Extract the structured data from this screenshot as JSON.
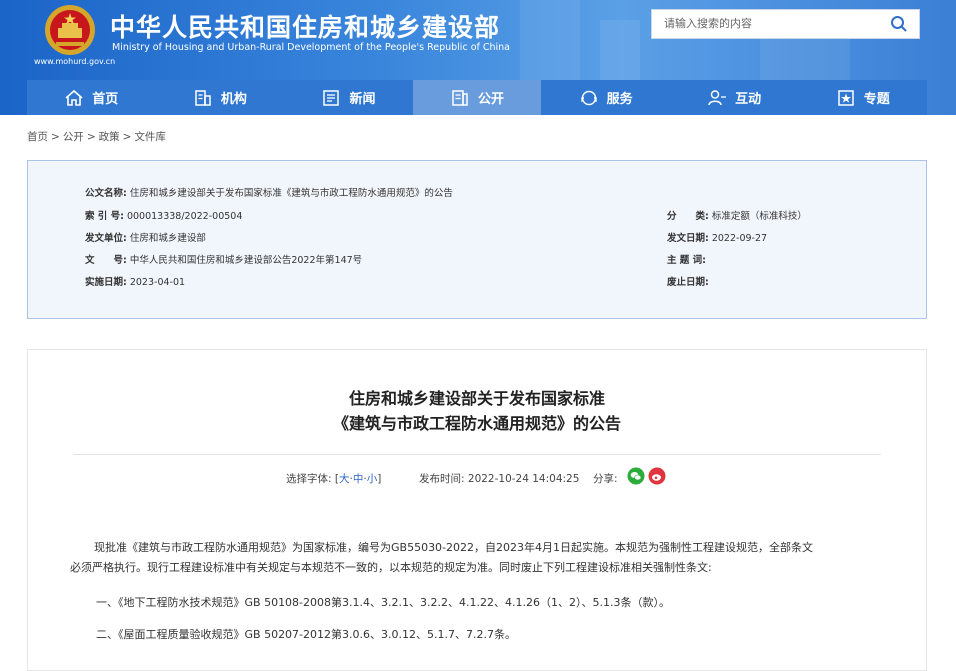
{
  "header": {
    "site_title": "中华人民共和国住房和城乡建设部",
    "site_subtitle": "Ministry of Housing and Urban-Rural Development of the People's Republic of China",
    "url": "www.mohurd.gov.cn",
    "search_placeholder": "请输入搜索的内容"
  },
  "nav": [
    {
      "label": "首页",
      "icon": "home-icon"
    },
    {
      "label": "机构",
      "icon": "building-icon"
    },
    {
      "label": "新闻",
      "icon": "news-icon"
    },
    {
      "label": "公开",
      "icon": "disclosure-icon",
      "active": true
    },
    {
      "label": "服务",
      "icon": "service-icon"
    },
    {
      "label": "互动",
      "icon": "interact-icon"
    },
    {
      "label": "专题",
      "icon": "topic-icon"
    }
  ],
  "breadcrumb": [
    "首页",
    "公开",
    "政策",
    "文件库"
  ],
  "info": {
    "title_key": "公文名称:",
    "title_val": "住房和城乡建设部关于发布国家标准《建筑与市政工程防水通用规范》的公告",
    "index_key": "索 引 号:",
    "index_val": "000013338/2022-00504",
    "category_key": "分　　类:",
    "category_val": "标准定额（标准科技）",
    "issuer_key": "发文单位:",
    "issuer_val": "住房和城乡建设部",
    "date_key": "发文日期:",
    "date_val": "2022-09-27",
    "docno_key": "文　　号:",
    "docno_val": "中华人民共和国住房和城乡建设部公告2022年第147号",
    "subject_key": "主 题 词:",
    "subject_val": "",
    "impl_key": "实施日期:",
    "impl_val": "2023-04-01",
    "abolish_key": "废止日期:",
    "abolish_val": ""
  },
  "article": {
    "title_line1": "住房和城乡建设部关于发布国家标准",
    "title_line2": "《建筑与市政工程防水通用规范》的公告",
    "font_label": "选择字体:",
    "font_open": "[",
    "font_large": "大",
    "font_dot1": "·",
    "font_medium": "中",
    "font_dot2": "·",
    "font_small": "小",
    "font_close": "]",
    "publish_label": "发布时间:",
    "publish_time": "2022-10-24 14:04:25",
    "share_label": "分享:",
    "para1a": "现批准《建筑与市政工程防水通用规范》为国家标准，编号为GB55030-2022，自2023年4月1日起实施。本规范为强制性工程建设规范，全部条文",
    "para1b": "必须严格执行。现行工程建设标准中有关规定与本规范不一致的，以本规范的规定为准。同时废止下列工程建设标准相关强制性条文:",
    "para2": "一、《地下工程防水技术规范》GB 50108-2008第3.1.4、3.2.1、3.2.2、4.1.22、4.1.26（1、2）、5.1.3条（款）。",
    "para3": "二、《屋面工程质量验收规范》GB 50207-2012第3.0.6、3.0.12、5.1.7、7.2.7条。"
  },
  "colors": {
    "header_blue": "#2f77d0",
    "info_bg": "#f1f6fc",
    "link_blue": "#2a64c4",
    "wechat_green": "#2dac3b",
    "weibo_red": "#e0353f"
  }
}
